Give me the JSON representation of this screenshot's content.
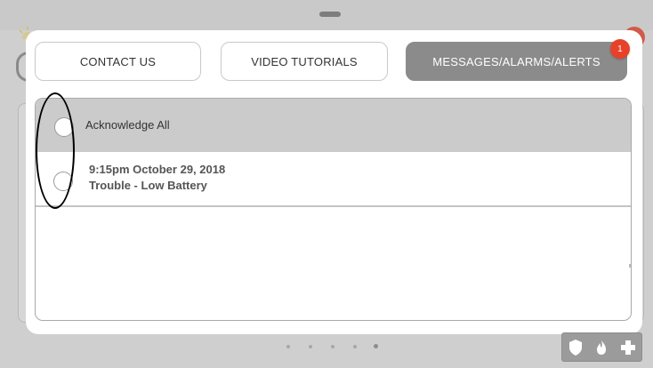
{
  "tabs": [
    {
      "label": "CONTACT US"
    },
    {
      "label": "VIDEO TUTORIALS"
    },
    {
      "label": "MESSAGES/ALARMS/ALERTS",
      "badge": "1",
      "active": true
    }
  ],
  "acknowledge_all": {
    "label": "Acknowledge All"
  },
  "messages": [
    {
      "time": "9:15pm October 29, 2018",
      "text": "Trouble - Low Battery"
    }
  ],
  "pagination": {
    "count": 5,
    "active_index": 4
  },
  "bottom_icons": [
    "shield-icon",
    "fire-icon",
    "medical-cross-icon"
  ],
  "colors": {
    "active_tab": "#8b8b8b",
    "badge": "#e8412a",
    "ack_row": "#cbcbcb",
    "annotation": "#000000"
  }
}
